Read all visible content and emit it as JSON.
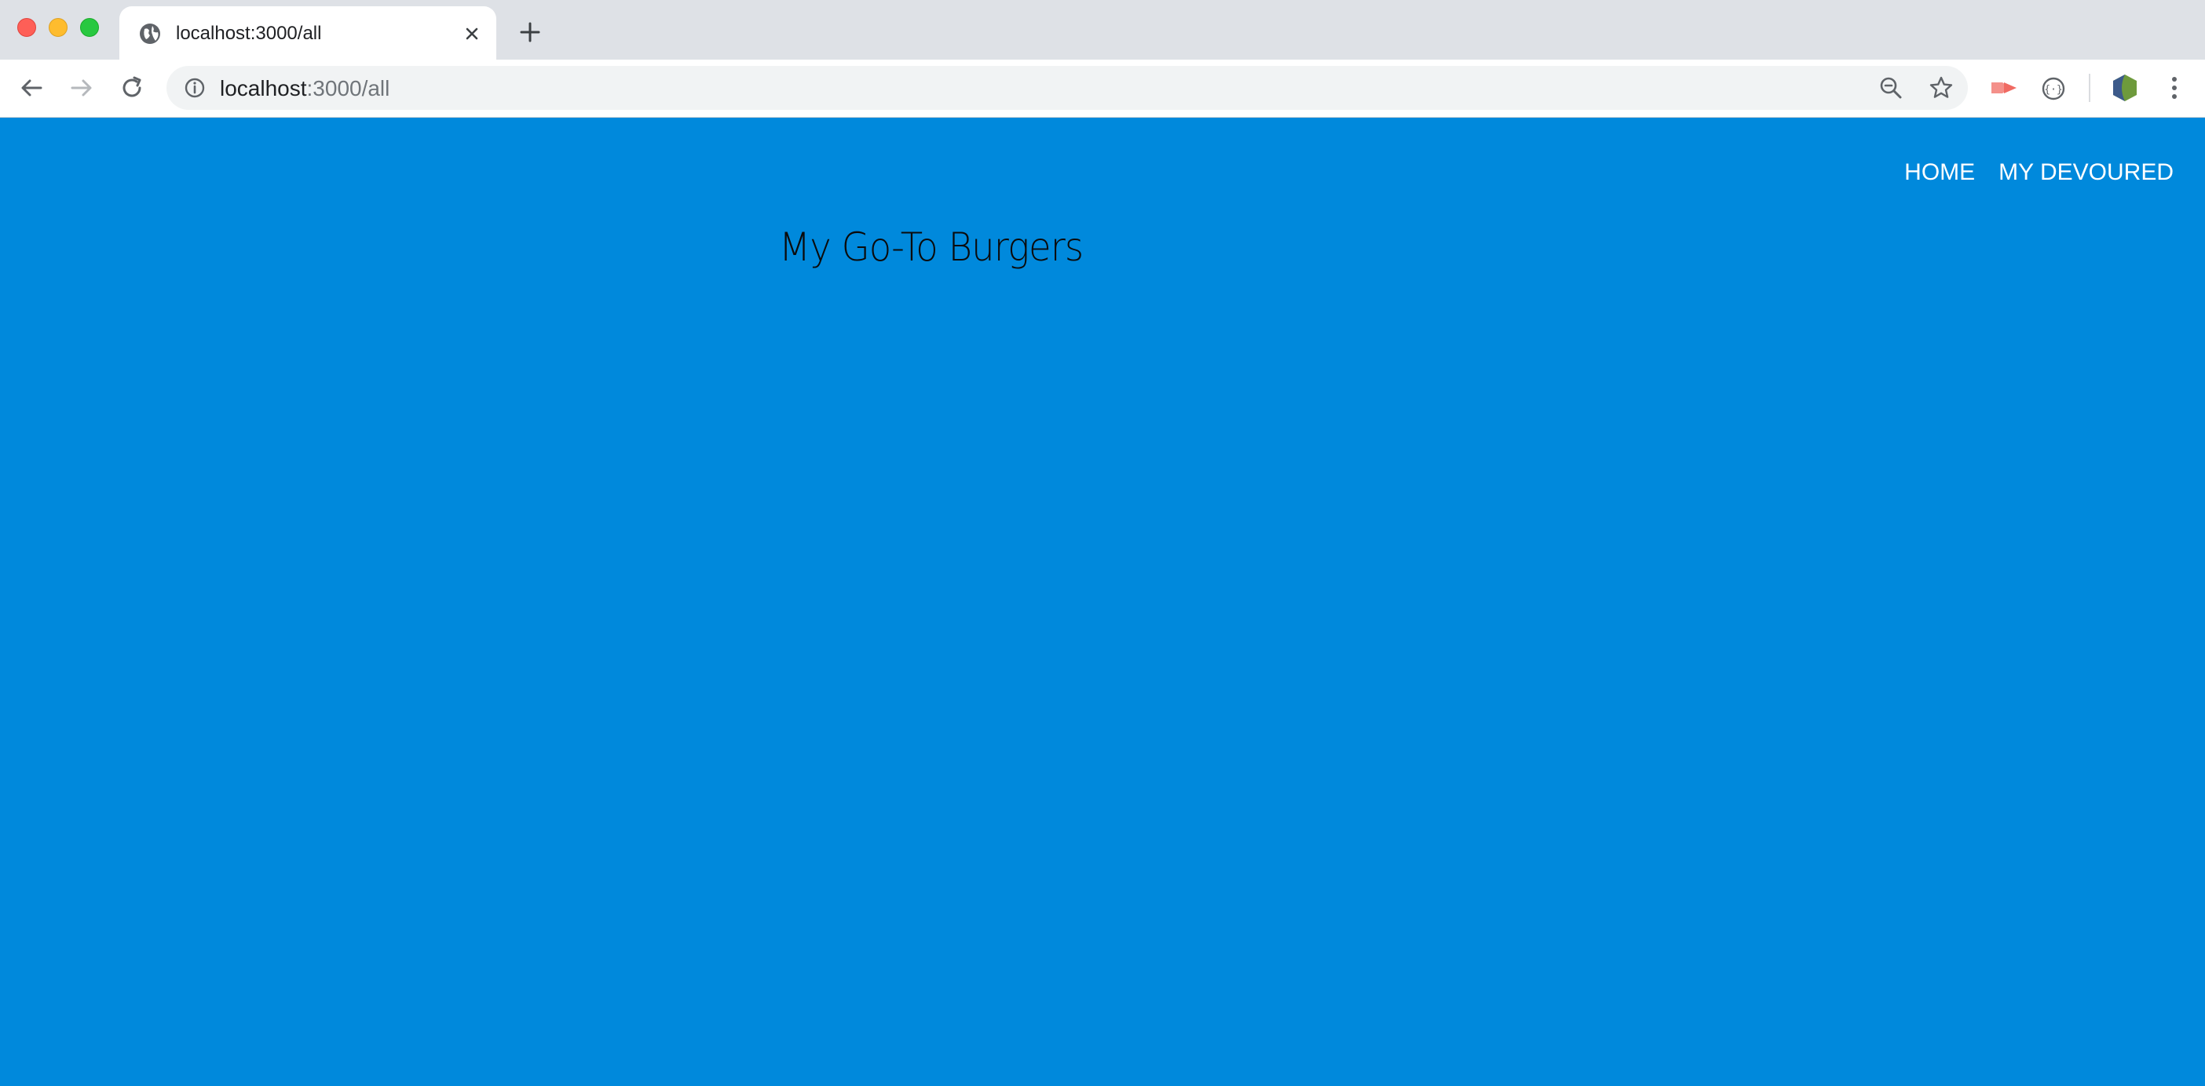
{
  "browser": {
    "tab": {
      "title": "localhost:3000/all",
      "favicon": "globe-icon"
    },
    "address_bar": {
      "host": "localhost",
      "path": ":3000/all"
    },
    "icons": [
      "back-icon",
      "forward-icon",
      "reload-icon",
      "info-icon",
      "zoom-out-icon",
      "star-icon",
      "extension-icon",
      "extension-icon",
      "profile-icon",
      "menu-icon"
    ]
  },
  "page": {
    "background": "#0089dc",
    "nav": {
      "home_label": "HOME",
      "devoured_label": "MY DEVOURED"
    },
    "heading": "My Go-To Burgers"
  }
}
